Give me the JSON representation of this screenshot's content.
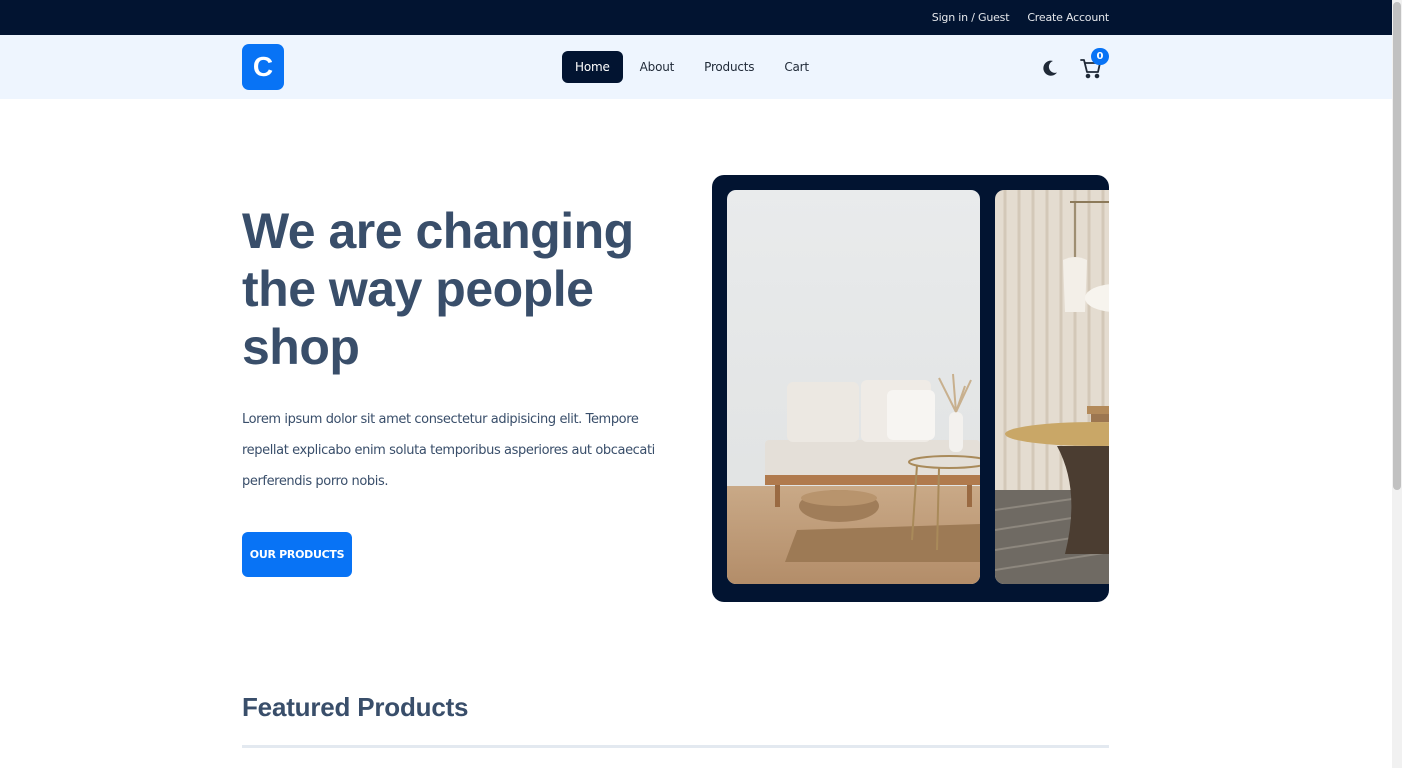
{
  "topbar": {
    "signin_label": "Sign in / Guest",
    "create_account_label": "Create Account"
  },
  "navbar": {
    "logo_letter": "C",
    "links": [
      {
        "label": "Home",
        "active": true
      },
      {
        "label": "About",
        "active": false
      },
      {
        "label": "Products",
        "active": false
      },
      {
        "label": "Cart",
        "active": false
      }
    ],
    "theme_icon": "moon-icon",
    "cart_icon": "cart-icon",
    "cart_count": "0"
  },
  "hero": {
    "title": "We are changing the way people shop",
    "description": "Lorem ipsum dolor sit amet consectetur adipisicing elit. Tempore repellat explicabo enim soluta temporibus asperiores aut obcaecati perferendis porro nobis.",
    "cta_label": "OUR PRODUCTS"
  },
  "featured": {
    "title": "Featured Products"
  },
  "colors": {
    "topbar": "#021431",
    "navbar": "#eef5fe",
    "primary": "#0873f5",
    "text": "#394e6a"
  }
}
